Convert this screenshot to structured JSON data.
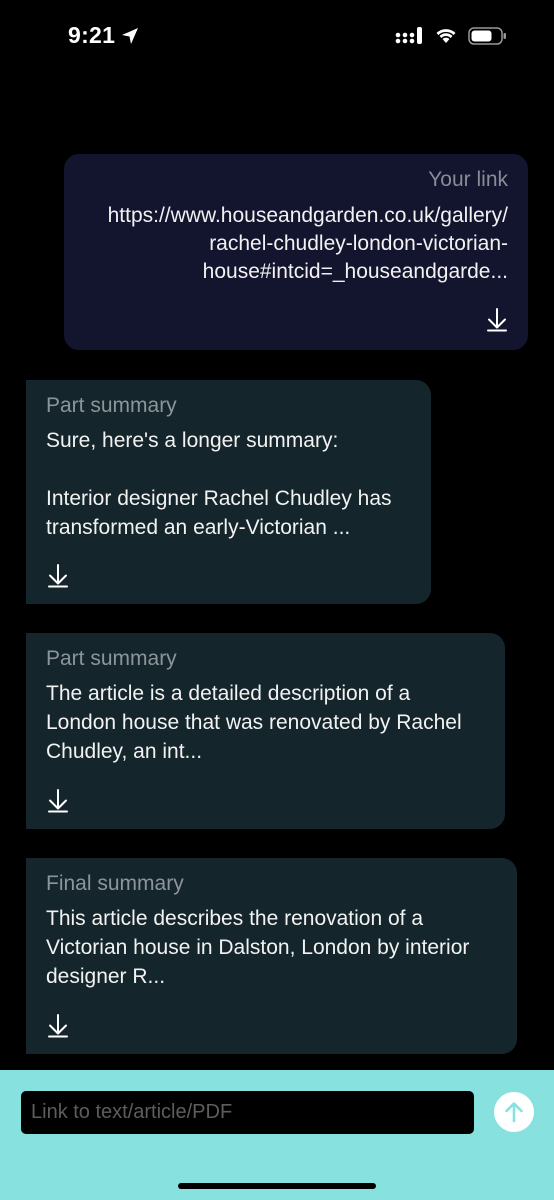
{
  "status_bar": {
    "time": "9:21"
  },
  "messages": [
    {
      "role": "user",
      "title": "Your link",
      "text": "https://www.houseandgarden.co.uk/gallery/rachel-chudley-london-victorian-house#intcid=_houseandgarde..."
    },
    {
      "role": "bot",
      "title": "Part summary",
      "text": "Sure, here's a longer summary:\n\nInterior designer Rachel Chudley has transformed an early-Victorian ..."
    },
    {
      "role": "bot",
      "title": "Part summary",
      "text": "The article is a detailed description of a London house that was renovated by Rachel Chudley, an int..."
    },
    {
      "role": "bot",
      "title": "Final summary",
      "text": "This article describes the renovation of a Victorian house in Dalston, London by interior designer R..."
    }
  ],
  "input": {
    "placeholder": "Link to text/article/PDF",
    "value": ""
  },
  "colors": {
    "user_bubble": "#13142e",
    "bot_bubble": "#14252c",
    "input_bar": "#87e2df",
    "send_arrow": "#87e2df"
  },
  "icons": {
    "download": "download-icon",
    "send": "arrow-up-icon",
    "location": "location-arrow-icon",
    "signal": "cellular-signal-icon",
    "wifi": "wifi-icon",
    "battery": "battery-icon"
  }
}
